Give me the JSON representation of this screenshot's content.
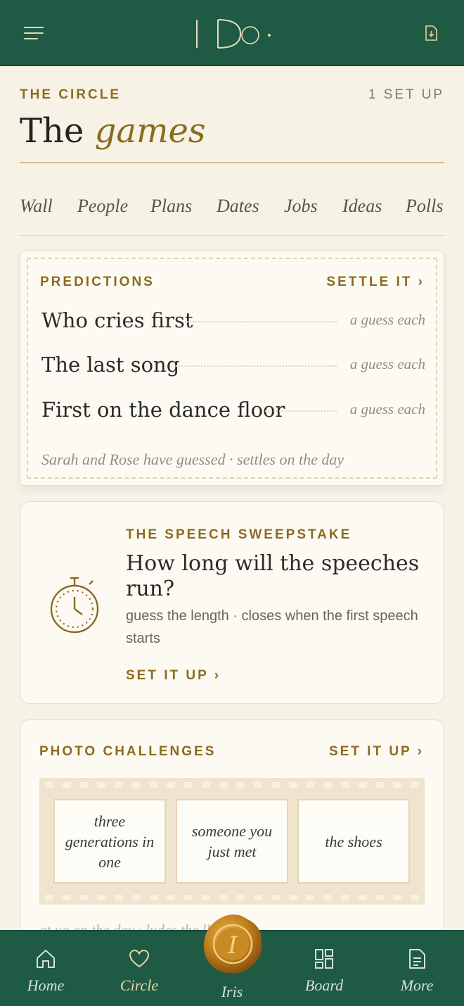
{
  "app": {
    "logo_text": "I Do",
    "brand_color": "#1f5a45",
    "accent_color": "#8b6b1f"
  },
  "topbar": {
    "menu_icon": "hamburger-menu-icon",
    "download_icon": "document-download-icon"
  },
  "header": {
    "eyebrow": "THE CIRCLE",
    "setup_count": "1 SET UP",
    "title_plain": "The",
    "title_italic": "games"
  },
  "tabs": [
    "Wall",
    "People",
    "Plans",
    "Dates",
    "Jobs",
    "Ideas",
    "Polls"
  ],
  "predictions": {
    "label": "PREDICTIONS",
    "link": "SETTLE IT ›",
    "items": [
      {
        "question": "Who cries first",
        "hint": "a guess each"
      },
      {
        "question": "The last song",
        "hint": "a guess each"
      },
      {
        "question": "First on the dance floor",
        "hint": "a guess each"
      }
    ],
    "footer": "Sarah and Rose have guessed · settles on the day"
  },
  "sweepstake": {
    "icon": "stopwatch-icon",
    "label": "THE SPEECH SWEEPSTAKE",
    "title": "How long will the speeches run?",
    "description": "guess the length · closes when the first speech starts",
    "link": "SET IT UP ›"
  },
  "photo_challenges": {
    "label": "PHOTO CHALLENGES",
    "link": "SET IT UP ›",
    "frames": [
      "three generations in one",
      "someone you just met",
      "the shoes"
    ],
    "footer": "at uo on the day · ludes the ll"
  },
  "bottom_nav": {
    "items": [
      {
        "label": "Home",
        "icon": "home-icon"
      },
      {
        "label": "Circle",
        "icon": "heart-icon"
      },
      {
        "label": "Board",
        "icon": "grid-icon"
      },
      {
        "label": "More",
        "icon": "document-icon"
      }
    ],
    "center": {
      "label": "Iris",
      "seal_letter": "I",
      "icon": "wax-seal-icon"
    }
  }
}
